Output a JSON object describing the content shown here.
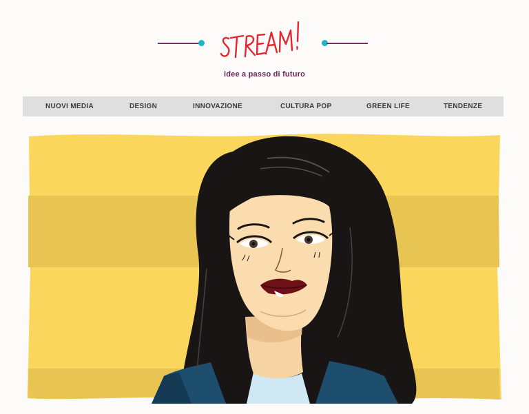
{
  "brand": {
    "logo_text": "STREAM!",
    "tagline": "idee a passo di futuro",
    "logo_color": "#e3262d",
    "accent_line_color": "#7a2d6b",
    "accent_dot_color": "#1fb3c7"
  },
  "nav": {
    "items": [
      {
        "label": "NUOVI MEDIA"
      },
      {
        "label": "DESIGN"
      },
      {
        "label": "INNOVAZIONE"
      },
      {
        "label": "CULTURA POP"
      },
      {
        "label": "GREEN LIFE"
      },
      {
        "label": "TENDENZE"
      }
    ]
  },
  "hero": {
    "illustration": "portrait-illustration",
    "background_colors": [
      "#fad75c",
      "#e8c553"
    ]
  }
}
